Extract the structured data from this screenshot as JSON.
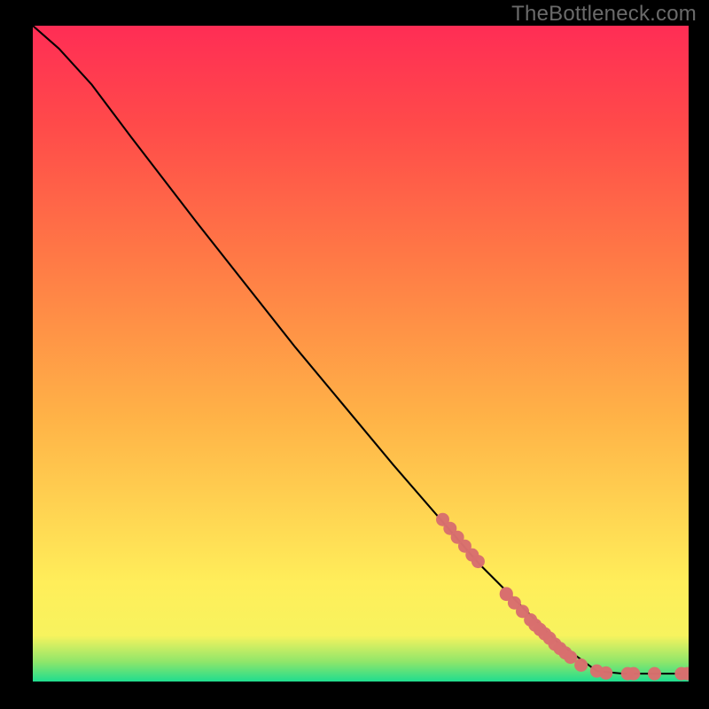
{
  "watermark": "TheBottleneck.com",
  "chart_data": {
    "type": "line",
    "title": "",
    "xlabel": "",
    "ylabel": "",
    "xlim": [
      0,
      100
    ],
    "ylim": [
      0,
      100
    ],
    "background": {
      "kind": "vertical-gradient",
      "stops": [
        {
          "pct": 0,
          "color": "#20dd8f"
        },
        {
          "pct": 3,
          "color": "#8fe66a"
        },
        {
          "pct": 7,
          "color": "#f7f35e"
        },
        {
          "pct": 15,
          "color": "#ffee5a"
        },
        {
          "pct": 40,
          "color": "#ffb347"
        },
        {
          "pct": 65,
          "color": "#ff7846"
        },
        {
          "pct": 85,
          "color": "#ff4a4a"
        },
        {
          "pct": 100,
          "color": "#ff2d55"
        }
      ]
    },
    "series": [
      {
        "name": "curve",
        "color": "#000000",
        "points": [
          {
            "x": 0,
            "y": 100
          },
          {
            "x": 4,
            "y": 96.5
          },
          {
            "x": 9,
            "y": 91
          },
          {
            "x": 15,
            "y": 83
          },
          {
            "x": 25,
            "y": 70
          },
          {
            "x": 40,
            "y": 51
          },
          {
            "x": 55,
            "y": 33
          },
          {
            "x": 68,
            "y": 18
          },
          {
            "x": 80,
            "y": 6
          },
          {
            "x": 86,
            "y": 1.6
          },
          {
            "x": 90,
            "y": 1.2
          },
          {
            "x": 94,
            "y": 1.2
          },
          {
            "x": 98,
            "y": 1.2
          },
          {
            "x": 100,
            "y": 1.2
          }
        ]
      }
    ],
    "marker_runs": [
      {
        "from": {
          "x": 62.5,
          "y": 24.7
        },
        "to": {
          "x": 67,
          "y": 19.3
        },
        "count": 5
      },
      {
        "from": {
          "x": 67.9,
          "y": 18.3
        },
        "to": {
          "x": 72.2,
          "y": 13.4
        },
        "count": 2
      },
      {
        "from": {
          "x": 72.2,
          "y": 13.3
        },
        "to": {
          "x": 75.9,
          "y": 9.4
        },
        "count": 4
      },
      {
        "from": {
          "x": 76.6,
          "y": 8.6
        },
        "to": {
          "x": 78.8,
          "y": 6.6
        },
        "count": 4
      },
      {
        "from": {
          "x": 79.6,
          "y": 5.7
        },
        "to": {
          "x": 82,
          "y": 3.7
        },
        "count": 4
      },
      {
        "from": {
          "x": 83.6,
          "y": 2.5
        },
        "to": {
          "x": 86,
          "y": 1.6
        },
        "count": 2
      },
      {
        "from": {
          "x": 87.4,
          "y": 1.3
        },
        "to": {
          "x": 87.4,
          "y": 1.3
        },
        "count": 1
      },
      {
        "from": {
          "x": 90.7,
          "y": 1.2
        },
        "to": {
          "x": 91.6,
          "y": 1.2
        },
        "count": 2
      },
      {
        "from": {
          "x": 94.8,
          "y": 1.2
        },
        "to": {
          "x": 94.8,
          "y": 1.2
        },
        "count": 1
      },
      {
        "from": {
          "x": 98.9,
          "y": 1.2
        },
        "to": {
          "x": 99.8,
          "y": 1.2
        },
        "count": 2
      }
    ],
    "marker_style": {
      "radius_px": 7.5,
      "fill": "#d86f6e",
      "alpha": 0.98
    }
  }
}
